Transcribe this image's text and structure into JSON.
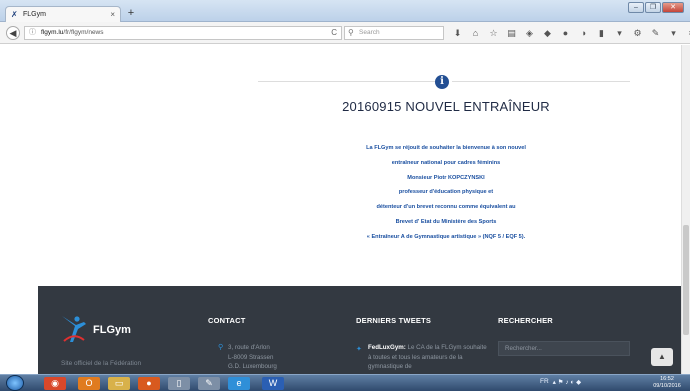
{
  "browser": {
    "tab_title": "FLGym",
    "tab_close": "×",
    "new_tab": "+",
    "url_host": "flgym.lu",
    "url_path": "/fr/flgym/news",
    "reload": "C",
    "search_placeholder": "Search",
    "window_controls": [
      "–",
      "❐",
      "✕"
    ]
  },
  "article": {
    "title": "20160915 NOUVEL ENTRAÎNEUR",
    "lines": [
      "La FLGym se réjouit de souhaiter la bienvenue à son nouvel",
      "entraîneur national pour cadres féminins",
      "Monsieur Piotr KOPCZYNSKI",
      "professeur d'éducation physique et",
      "détenteur d'un brevet reconnu comme équivalent au",
      "Brevet d' Etat du Ministère des Sports",
      "« Entraîneur A de Gymnastique artistique » (NQF 5 / EQF 5)."
    ],
    "accent_color": "#1a4fa0",
    "icon": "info-icon"
  },
  "footer": {
    "logo_text": "FLGym",
    "tagline": "Site officiel de la Fédération",
    "contact_heading": "CONTACT",
    "contact_lines": [
      "3, route d'Arlon",
      "L-8009 Strassen",
      "G.D. Luxembourg"
    ],
    "tweets_heading": "DERNIERS TWEETS",
    "tweet_author": "FedLuxGym:",
    "tweet_text": " Le CA de la FLGym souhaite à toutes et tous les amateurs de la gymnastique de",
    "search_heading": "RECHERCHER",
    "search_placeholder": "Rechercher...",
    "background_color": "#333941",
    "link_color": "#2c8fd8"
  },
  "taskbar": {
    "tray_lang": "FR",
    "clock_time": "16:52",
    "clock_date": "09/10/2016"
  }
}
